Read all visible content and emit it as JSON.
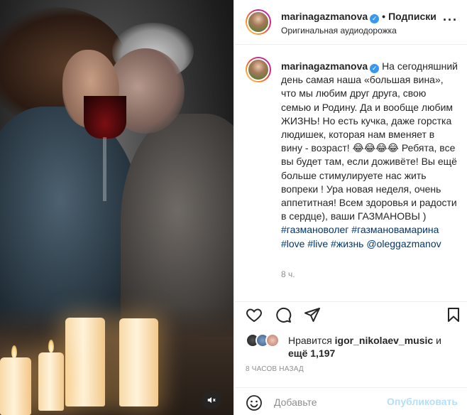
{
  "post": {
    "username": "marinagazmanova",
    "follow_separator": "•",
    "follow_label": "Подписки",
    "audio_label": "Оригинальная аудиодорожка",
    "more_label": "···"
  },
  "caption": {
    "username": "marinagazmanova",
    "text_part1": "На сегодняшний день самая наша «большая вина», что мы любим друг друга, свою семью и Родину. Да и вообще любим ЖИЗНЬ! Но есть кучка, даже горстка людишек, которая нам вменяет в вину - возраст! 😂😂😂😂 Ребята, все вы будет там, если доживёте! Вы ещё больше стимулируете нас жить вопреки ! Ура новая неделя, очень аппетитная! Всем здоровья и радости в сердце), ваши ГАЗМАНОВЫ ) ",
    "hashtag1": "#газмановолег",
    "hashtag2": "#газмановамарина",
    "hashtag3": "#love",
    "hashtag4": "#live",
    "hashtag5": "#жизнь",
    "mention": "@oleggazmanov",
    "time": "8 ч."
  },
  "likes": {
    "prefix": "Нравится",
    "user": "igor_nikolaev_music",
    "and": "и",
    "more": "ещё 1,197"
  },
  "posted_ago": "8 ЧАСОВ НАЗАД",
  "comment_box": {
    "placeholder": "Добавьте",
    "publish_label": "Опубликовать"
  },
  "icons": [
    "heart-icon",
    "comment-icon",
    "share-icon",
    "bookmark-icon",
    "emoji-icon",
    "audio-muted-icon",
    "verified-icon"
  ],
  "colors": {
    "link": "#00376b",
    "verified": "#3897f0",
    "publish_disabled": "#b2dffc",
    "muted": "#8e8e8e"
  }
}
